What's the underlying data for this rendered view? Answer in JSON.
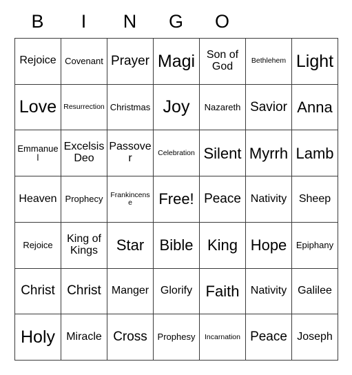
{
  "card": {
    "title_letters": [
      "B",
      "I",
      "N",
      "G",
      "O"
    ],
    "columns": 7,
    "rows": 7,
    "free_space_label": "Free!",
    "grid_line_color": "#3a3a3a",
    "background_color": "#ffffff",
    "text_color": "#000000",
    "cells": [
      [
        {
          "label": "Rejoice",
          "size": "md"
        },
        {
          "label": "Covenant",
          "size": "sm"
        },
        {
          "label": "Prayer",
          "size": "lg"
        },
        {
          "label": "Magi",
          "size": "xxl"
        },
        {
          "label": "Son of God",
          "size": "md"
        },
        {
          "label": "Bethlehem",
          "size": "xs"
        },
        {
          "label": "Light",
          "size": "xxl"
        }
      ],
      [
        {
          "label": "Love",
          "size": "xxl"
        },
        {
          "label": "Resurrection",
          "size": "xs"
        },
        {
          "label": "Christmas",
          "size": "sm"
        },
        {
          "label": "Joy",
          "size": "xxl"
        },
        {
          "label": "Nazareth",
          "size": "sm"
        },
        {
          "label": "Savior",
          "size": "lg"
        },
        {
          "label": "Anna",
          "size": "xl"
        }
      ],
      [
        {
          "label": "Emmanuel",
          "size": "sm"
        },
        {
          "label": "Excelsis Deo",
          "size": "md"
        },
        {
          "label": "Passover",
          "size": "md"
        },
        {
          "label": "Celebration",
          "size": "xs"
        },
        {
          "label": "Silent",
          "size": "xl"
        },
        {
          "label": "Myrrh",
          "size": "xl"
        },
        {
          "label": "Lamb",
          "size": "xl"
        }
      ],
      [
        {
          "label": "Heaven",
          "size": "md"
        },
        {
          "label": "Prophecy",
          "size": "sm"
        },
        {
          "label": "Frankincense",
          "size": "xs"
        },
        {
          "label": "Free!",
          "size": "xl"
        },
        {
          "label": "Peace",
          "size": "lg"
        },
        {
          "label": "Nativity",
          "size": "md"
        },
        {
          "label": "Sheep",
          "size": "md"
        }
      ],
      [
        {
          "label": "Rejoice",
          "size": "sm"
        },
        {
          "label": "King of Kings",
          "size": "md"
        },
        {
          "label": "Star",
          "size": "xl"
        },
        {
          "label": "Bible",
          "size": "xl"
        },
        {
          "label": "King",
          "size": "xl"
        },
        {
          "label": "Hope",
          "size": "xl"
        },
        {
          "label": "Epiphany",
          "size": "sm"
        }
      ],
      [
        {
          "label": "Christ",
          "size": "lg"
        },
        {
          "label": "Christ",
          "size": "lg"
        },
        {
          "label": "Manger",
          "size": "md"
        },
        {
          "label": "Glorify",
          "size": "md"
        },
        {
          "label": "Faith",
          "size": "xl"
        },
        {
          "label": "Nativity",
          "size": "md"
        },
        {
          "label": "Galilee",
          "size": "md"
        }
      ],
      [
        {
          "label": "Holy",
          "size": "xxl"
        },
        {
          "label": "Miracle",
          "size": "md"
        },
        {
          "label": "Cross",
          "size": "lg"
        },
        {
          "label": "Prophesy",
          "size": "sm"
        },
        {
          "label": "Incarnation",
          "size": "xs"
        },
        {
          "label": "Peace",
          "size": "lg"
        },
        {
          "label": "Joseph",
          "size": "md"
        }
      ]
    ]
  }
}
